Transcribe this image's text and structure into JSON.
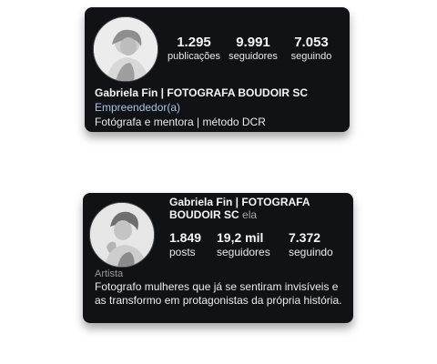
{
  "profile_top": {
    "name": "Gabriela Fin | FOTOGRAFA BOUDOIR SC",
    "category": "Empreendedor(a)",
    "bio": "Fotógrafa e mentora | método DCR",
    "stats": {
      "posts": {
        "value": "1.295",
        "label": "publicações"
      },
      "followers": {
        "value": "9.991",
        "label": "seguidores"
      },
      "following": {
        "value": "7.053",
        "label": "seguindo"
      }
    }
  },
  "profile_bottom": {
    "name": "Gabriela Fin | FOTOGRAFA BOUDOIR SC",
    "pronoun": "ela",
    "category": "Artista",
    "bio": "Fotografo mulheres que já se sentiram invisíveis e as transformo em protagonistas da própria história.",
    "stats": {
      "posts": {
        "value": "1.849",
        "label": "posts"
      },
      "followers": {
        "value": "19,2 mil",
        "label": "seguidores"
      },
      "following": {
        "value": "7.372",
        "label": "seguindo"
      }
    }
  },
  "colors": {
    "card_bg": "#111216",
    "category_link": "#a9c4e8",
    "category_muted": "#9a9a9a"
  }
}
